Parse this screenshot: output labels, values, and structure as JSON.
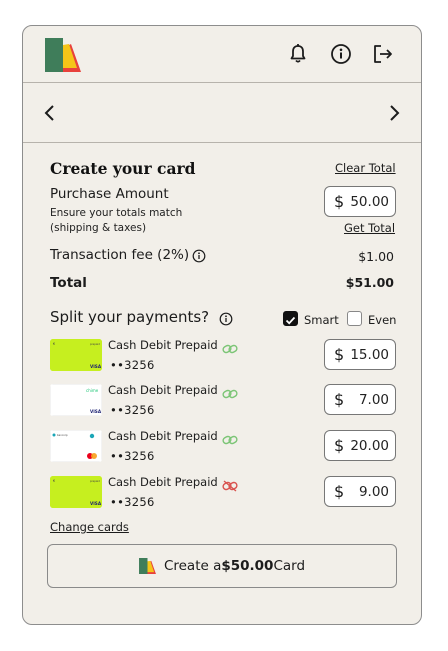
{
  "header": {
    "icons": [
      "bell-icon",
      "info-icon",
      "logout-icon"
    ]
  },
  "create": {
    "title": "Create your card",
    "clear_total": "Clear Total",
    "purchase_label": "Purchase Amount",
    "purchase_hint_1": "Ensure your totals match",
    "purchase_hint_2": "(shipping & taxes)",
    "currency": "$",
    "purchase_amount": "50.00",
    "get_total": "Get Total",
    "fee_label": "Transaction fee (2%)",
    "fee_value": "$1.00",
    "total_label": "Total",
    "total_value": "$51.00"
  },
  "split": {
    "title": "Split your payments?",
    "smart_label": "Smart",
    "smart_checked": true,
    "even_label": "Even",
    "even_checked": false,
    "cards": [
      {
        "name": "Cash Debit Prepaid",
        "number": "••3256",
        "amount": "15.00",
        "theme": "lime",
        "network": "VISA",
        "linked": true
      },
      {
        "name": "Cash Debit Prepaid",
        "number": "••3256",
        "amount": "7.00",
        "theme": "white-chime",
        "network": "VISA",
        "linked": true
      },
      {
        "name": "Cash Debit Prepaid",
        "number": "••3256",
        "amount": "20.00",
        "theme": "white-mc",
        "network": "mastercard",
        "linked": true
      },
      {
        "name": "Cash Debit Prepaid",
        "number": "••3256",
        "amount": "9.00",
        "theme": "lime",
        "network": "VISA",
        "linked": false
      }
    ],
    "change_cards": "Change cards"
  },
  "cta": {
    "prefix": "Create a ",
    "amount": "$50.00",
    "suffix": " Card"
  },
  "colors": {
    "panel_bg": "#f2efe9",
    "lime": "#c6ef1f",
    "link_green": "#7cc576",
    "unlink_red": "#d9534f",
    "logo_green": "#3f7d5a",
    "logo_yellow": "#f5c518",
    "logo_red": "#e8413c"
  }
}
